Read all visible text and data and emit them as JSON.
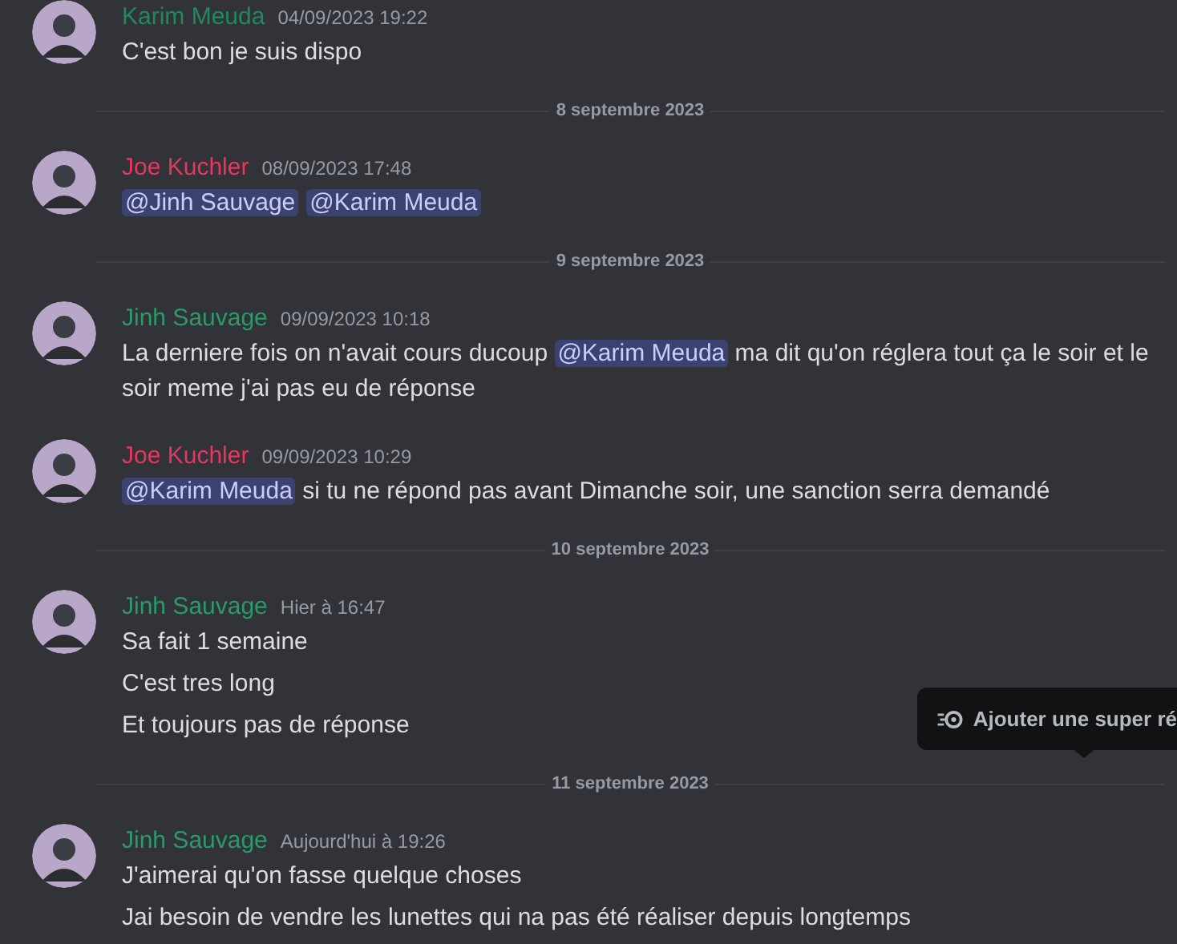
{
  "feed": [
    {
      "kind": "message",
      "author": "Karim Meuda",
      "color": "#1f8b5c",
      "timestamp": "04/09/2023 19:22",
      "lines": [
        [
          {
            "kind": "text",
            "text": "C'est bon je suis dispo"
          }
        ]
      ]
    },
    {
      "kind": "divider",
      "label": "8 septembre 2023"
    },
    {
      "kind": "message",
      "author": "Joe Kuchler",
      "color": "#e8365f",
      "timestamp": "08/09/2023 17:48",
      "lines": [
        [
          {
            "kind": "mention",
            "text": "@Jinh Sauvage"
          },
          {
            "kind": "mention",
            "text": "@Karim Meuda"
          }
        ]
      ]
    },
    {
      "kind": "divider",
      "label": "9 septembre 2023"
    },
    {
      "kind": "message",
      "author": "Jinh Sauvage",
      "color": "#2a9a6a",
      "timestamp": "09/09/2023 10:18",
      "lines": [
        [
          {
            "kind": "text",
            "text": "La derniere fois on n'avait cours ducoup "
          },
          {
            "kind": "mention",
            "text": "@Karim Meuda"
          },
          {
            "kind": "text",
            "text": " ma dit qu'on réglera tout ça le soir et le soir meme j'ai pas eu de réponse"
          }
        ]
      ]
    },
    {
      "kind": "message",
      "author": "Joe Kuchler",
      "color": "#e8365f",
      "timestamp": "09/09/2023 10:29",
      "lines": [
        [
          {
            "kind": "mention",
            "text": "@Karim Meuda"
          },
          {
            "kind": "text",
            "text": " si tu ne répond pas avant Dimanche soir, une sanction serra demandé"
          }
        ]
      ]
    },
    {
      "kind": "divider",
      "label": "10 septembre 2023"
    },
    {
      "kind": "message",
      "author": "Jinh Sauvage",
      "color": "#2a9a6a",
      "timestamp": "Hier à 16:47",
      "lines": [
        [
          {
            "kind": "text",
            "text": "Sa fait 1 semaine"
          }
        ],
        [
          {
            "kind": "text",
            "text": "C'est tres long"
          }
        ],
        [
          {
            "kind": "text",
            "text": "Et toujours pas de réponse"
          }
        ]
      ]
    },
    {
      "kind": "divider",
      "label": "11 septembre 2023"
    },
    {
      "kind": "message",
      "author": "Jinh Sauvage",
      "color": "#2a9a6a",
      "timestamp": "Aujourd'hui à 19:26",
      "lines": [
        [
          {
            "kind": "text",
            "text": "J'aimerai qu'on fasse quelque choses"
          }
        ],
        [
          {
            "kind": "text",
            "text": "Jai besoin de vendre les lunettes qui na pas été réaliser depuis longtemps"
          }
        ]
      ]
    }
  ],
  "tooltip": {
    "label": "Ajouter une super ré"
  }
}
